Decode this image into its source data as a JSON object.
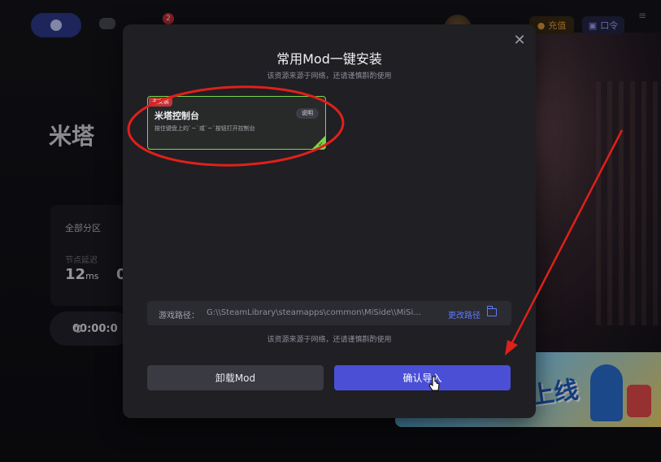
{
  "topbar": {
    "notification_count": "2",
    "recharge_label": "充值",
    "connect_label": "口令"
  },
  "game": {
    "title": "米塔",
    "region_label": "全部分区",
    "delay_label": "节点延迟",
    "delay_value": "12",
    "delay_unit": "ms",
    "second_value": "0",
    "timer": "00:00:0"
  },
  "banner": {
    "text": "上线"
  },
  "modal": {
    "title": "常用Mod一键安装",
    "subtitle": "该资源来源于网络，还请谨慎斟酌使用",
    "mod": {
      "tag": "未安装",
      "name": "米塔控制台",
      "description": "按住键盘上的`~`或`~`按钮打开控制台",
      "help_label": "说明"
    },
    "path_label": "游戏路径：",
    "path_value": "G:\\\\SteamLibrary\\steamapps\\common\\MiSide\\\\MiSi...",
    "path_change_label": "更改路径",
    "footer_note": "该资源来源于网络，还请谨慎斟酌使用",
    "uninstall_label": "卸载Mod",
    "confirm_label": "确认导入"
  },
  "colors": {
    "accent": "#4a4fd6",
    "mod_border": "#7bd64a",
    "tag_red": "#c0343c",
    "annotation_red": "#e0201a"
  }
}
